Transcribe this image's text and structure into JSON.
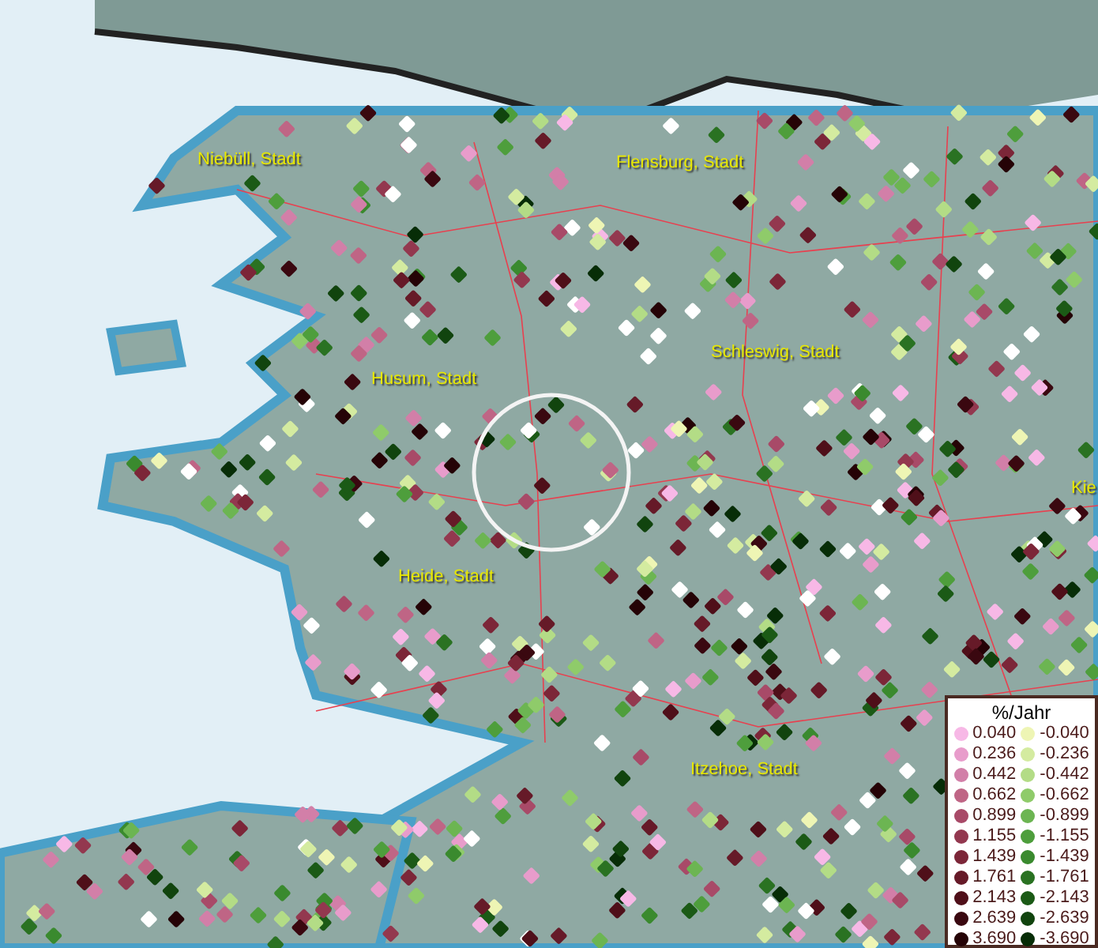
{
  "map": {
    "places": [
      {
        "name": "Niebüll, Stadt"
      },
      {
        "name": "Flensburg, Stadt"
      },
      {
        "name": "Schleswig, Stadt"
      },
      {
        "name": "Husum, Stadt"
      },
      {
        "name": "Kie"
      },
      {
        "name": "Heide, Stadt"
      },
      {
        "name": "Itzehoe, Stadt"
      }
    ]
  },
  "legend": {
    "title": "%/Jahr",
    "column_1": [
      {
        "label": "0.040",
        "color": "#f7b8e6"
      },
      {
        "label": "0.236",
        "color": "#e89ccb"
      },
      {
        "label": "0.442",
        "color": "#d27fa8"
      },
      {
        "label": "0.662",
        "color": "#bf6585"
      },
      {
        "label": "0.899",
        "color": "#a84a68"
      },
      {
        "label": "1.155",
        "color": "#93384f"
      },
      {
        "label": "1.439",
        "color": "#7c2638"
      },
      {
        "label": "1.761",
        "color": "#661a28"
      },
      {
        "label": "2.143",
        "color": "#4f0f19"
      },
      {
        "label": "2.639",
        "color": "#3a0810"
      },
      {
        "label": "3.690",
        "color": "#250306"
      }
    ],
    "column_2": [
      {
        "label": "-0.040",
        "color": "#eef5b4"
      },
      {
        "label": "-0.236",
        "color": "#d4eba0"
      },
      {
        "label": "-0.442",
        "color": "#b3dc86"
      },
      {
        "label": "-0.662",
        "color": "#8fcb6a"
      },
      {
        "label": "-0.899",
        "color": "#6cb552"
      },
      {
        "label": "-1.155",
        "color": "#4e9e3c"
      },
      {
        "label": "-1.439",
        "color": "#3a8a2e"
      },
      {
        "label": "-1.761",
        "color": "#2a7222"
      },
      {
        "label": "-2.143",
        "color": "#1b5a16"
      },
      {
        "label": "-2.639",
        "color": "#11440e"
      },
      {
        "label": "-3.690",
        "color": "#072d07"
      }
    ]
  }
}
